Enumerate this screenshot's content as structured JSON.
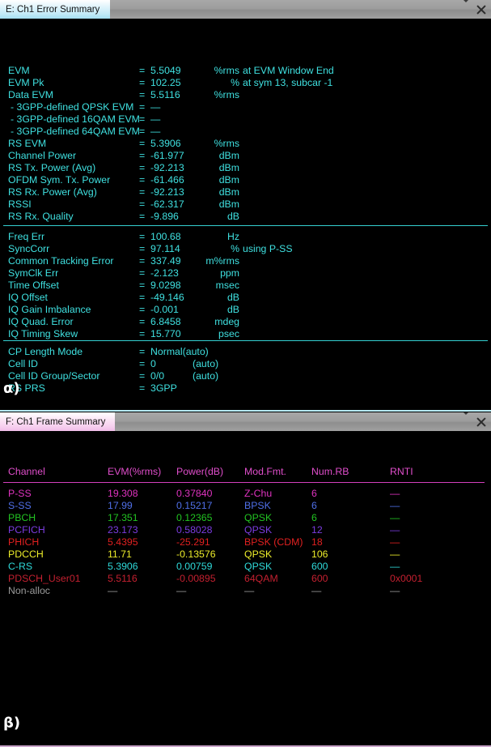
{
  "error_panel": {
    "tab_label": "E: Ch1 Error Summary",
    "corner_label": "α)",
    "icons": {
      "chevron": "chevron-down-icon",
      "close": "close-icon"
    },
    "accent_color": "#3fe0e0",
    "groups": [
      {
        "rows": [
          {
            "label": "EVM",
            "eq": "=",
            "value": "5.5049",
            "unit": "%rms",
            "extra": "at   EVM Window End"
          },
          {
            "label": "EVM Pk",
            "eq": "=",
            "value": "102.25",
            "unit": "%",
            "extra": "at   sym 13,   subcar   -1"
          },
          {
            "label": "Data EVM",
            "eq": "=",
            "value": "5.5116",
            "unit": "%rms",
            "extra": ""
          },
          {
            "label": "- 3GPP-defined QPSK EVM",
            "eq": "=",
            "value": "—",
            "unit": "",
            "extra": "",
            "indent": true
          },
          {
            "label": "- 3GPP-defined 16QAM EVM",
            "eq": "=",
            "value": "—",
            "unit": "",
            "extra": "",
            "indent": true
          },
          {
            "label": "- 3GPP-defined 64QAM EVM",
            "eq": "=",
            "value": "—",
            "unit": "",
            "extra": "",
            "indent": true
          },
          {
            "label": "RS EVM",
            "eq": "=",
            "value": "5.3906",
            "unit": "%rms",
            "extra": ""
          },
          {
            "label": "Channel Power",
            "eq": "=",
            "value": "-61.977",
            "unit": "dBm",
            "extra": ""
          },
          {
            "label": "RS Tx. Power (Avg)",
            "eq": "=",
            "value": "-92.213",
            "unit": "dBm",
            "extra": ""
          },
          {
            "label": "OFDM Sym. Tx. Power",
            "eq": "=",
            "value": "-61.466",
            "unit": "dBm",
            "extra": ""
          },
          {
            "label": "RS Rx. Power (Avg)",
            "eq": "=",
            "value": "-92.213",
            "unit": "dBm",
            "extra": ""
          },
          {
            "label": "RSSI",
            "eq": "=",
            "value": "-62.317",
            "unit": "dBm",
            "extra": ""
          },
          {
            "label": "RS Rx. Quality",
            "eq": "=",
            "value": "-9.896",
            "unit": "dB",
            "extra": ""
          }
        ]
      },
      {
        "rows": [
          {
            "label": "Freq Err",
            "eq": "=",
            "value": "100.68",
            "unit": "Hz",
            "extra": ""
          },
          {
            "label": "SyncCorr",
            "eq": "=",
            "value": "97.114",
            "unit": "%",
            "extra": "using   P-SS"
          },
          {
            "label": "Common Tracking Error",
            "eq": "=",
            "value": "337.49",
            "unit": "m%rms",
            "extra": ""
          },
          {
            "label": "SymClk Err",
            "eq": "=",
            "value": "-2.123",
            "unit": "ppm",
            "extra": ""
          },
          {
            "label": "Time Offset",
            "eq": "=",
            "value": "9.0298",
            "unit": "msec",
            "extra": ""
          },
          {
            "label": "IQ Offset",
            "eq": "=",
            "value": "-49.146",
            "unit": "dB",
            "extra": ""
          },
          {
            "label": "IQ Gain Imbalance",
            "eq": "=",
            "value": "-0.001",
            "unit": "dB",
            "extra": ""
          },
          {
            "label": "IQ Quad. Error",
            "eq": "=",
            "value": "6.8458",
            "unit": "mdeg",
            "extra": ""
          },
          {
            "label": "IQ Timing Skew",
            "eq": "=",
            "value": "15.770",
            "unit": "psec",
            "extra": ""
          }
        ]
      },
      {
        "rows": [
          {
            "label": "CP Length Mode",
            "eq": "=",
            "value": "Normal(auto)",
            "unit": "",
            "extra": ""
          },
          {
            "label": "Cell ID",
            "eq": "=",
            "value": "0",
            "unit": "",
            "extra": "(auto)"
          },
          {
            "label": "Cell ID Group/Sector",
            "eq": "=",
            "value": "0/0",
            "unit": "",
            "extra": "(auto)"
          },
          {
            "label": "RS PRS",
            "eq": "=",
            "value": "3GPP",
            "unit": "",
            "extra": ""
          }
        ]
      }
    ]
  },
  "frame_panel": {
    "tab_label": "F: Ch1 Frame Summary",
    "corner_label": "β)",
    "icons": {
      "chevron": "chevron-down-icon",
      "close": "close-icon"
    },
    "accent_color": "#e04ecb",
    "columns": [
      "Channel",
      "EVM(%rms)",
      "Power(dB)",
      "Mod.Fmt.",
      "Num.RB",
      "RNTI"
    ],
    "rows": [
      {
        "channel": "P-SS",
        "evm": "19.308",
        "power": "0.37840",
        "mod": "Z-Chu",
        "numrb": "6",
        "rnti": "—",
        "color": "#e033c0"
      },
      {
        "channel": "S-SS",
        "evm": "17.99",
        "power": "0.15217",
        "mod": "BPSK",
        "numrb": "6",
        "rnti": "—",
        "color": "#4f6fe8"
      },
      {
        "channel": "PBCH",
        "evm": "17.351",
        "power": "0.12365",
        "mod": "QPSK",
        "numrb": "6",
        "rnti": "—",
        "color": "#22c422"
      },
      {
        "channel": "PCFICH",
        "evm": "23.173",
        "power": "0.58028",
        "mod": "QPSK",
        "numrb": "12",
        "rnti": "—",
        "color": "#7b3ce0"
      },
      {
        "channel": "PHICH",
        "evm": "5.4395",
        "power": "-25.291",
        "mod": "BPSK (CDM)",
        "numrb": "18",
        "rnti": "—",
        "color": "#e02020"
      },
      {
        "channel": "PDCCH",
        "evm": "11.71",
        "power": "-0.13576",
        "mod": "QPSK",
        "numrb": "106",
        "rnti": "—",
        "color": "#eded2a"
      },
      {
        "channel": "C-RS",
        "evm": "5.3906",
        "power": "0.00759",
        "mod": "QPSK",
        "numrb": "600",
        "rnti": "—",
        "color": "#2fd9d9"
      },
      {
        "channel": "PDSCH_User01",
        "evm": "5.5116",
        "power": "-0.00895",
        "mod": "64QAM",
        "numrb": "600",
        "rnti": "0x0001",
        "color": "#c42030"
      },
      {
        "channel": "Non-alloc",
        "evm": "—",
        "power": "—",
        "mod": "—",
        "numrb": "—",
        "rnti": "—",
        "color": "#9a9a9a"
      }
    ]
  }
}
